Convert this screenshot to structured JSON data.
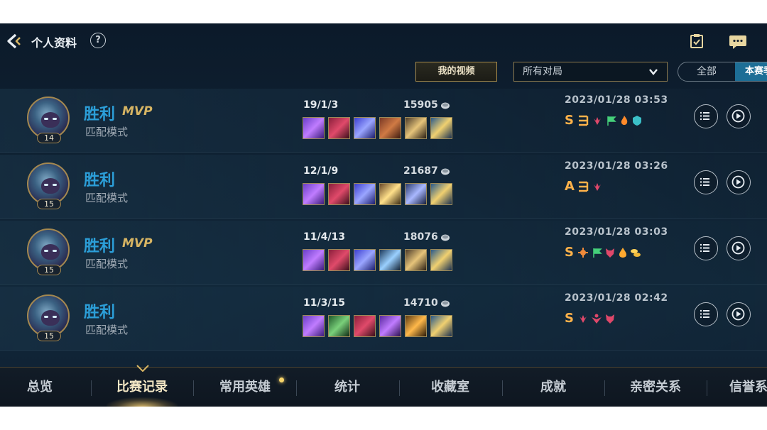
{
  "header": {
    "title": "个人资料",
    "help": "?"
  },
  "filters": {
    "video_button": "我的视频",
    "match_type": "所有对局",
    "segment": {
      "all": "全部",
      "season": "本赛季"
    }
  },
  "matches": [
    {
      "result": "胜利",
      "mvp": "MVP",
      "mode": "匹配模式",
      "level": "14",
      "kda": "19/1/3",
      "gold": "15905",
      "time": "2023/01/28 03:53",
      "grade": "S"
    },
    {
      "result": "胜利",
      "mvp": "",
      "mode": "匹配模式",
      "level": "15",
      "kda": "12/1/9",
      "gold": "21687",
      "time": "2023/01/28 03:26",
      "grade": "A"
    },
    {
      "result": "胜利",
      "mvp": "MVP",
      "mode": "匹配模式",
      "level": "15",
      "kda": "11/4/13",
      "gold": "18076",
      "time": "2023/01/28 03:03",
      "grade": "S"
    },
    {
      "result": "胜利",
      "mvp": "",
      "mode": "匹配模式",
      "level": "15",
      "kda": "11/3/15",
      "gold": "14710",
      "time": "2023/01/28 02:42",
      "grade": "S"
    }
  ],
  "tabs": [
    "总览",
    "比赛记录",
    "常用英雄",
    "统计",
    "收藏室",
    "成就",
    "亲密关系",
    "信誉系统"
  ],
  "active_tab": "比赛记录",
  "colors": {
    "victory": "#2c9fd9",
    "mvp": "#d6b463",
    "grade": "#ffb24a",
    "accent_gold": "#a68a4b",
    "season_selected": "#1d6e96"
  }
}
